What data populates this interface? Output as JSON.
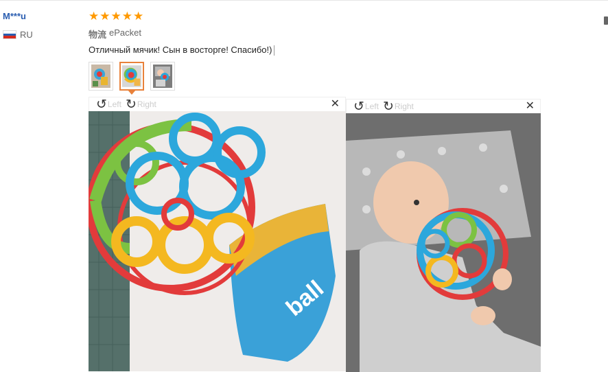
{
  "review": {
    "username": "M***u",
    "country_code": "RU",
    "star_count": 5,
    "rating_label": "★",
    "shipping_label": "物流",
    "shipping_method": "ePacket",
    "text": "Отличный мячик! Сын в восторге! Спасибо!)"
  },
  "colors": {
    "accent": "#e8813a",
    "star": "#ff9900",
    "username": "#2a5db0"
  },
  "viewers": [
    {
      "rotate_left_label": "Left",
      "rotate_right_label": "Right",
      "close_label": "✕"
    },
    {
      "rotate_left_label": "Left",
      "rotate_right_label": "Right",
      "close_label": "✕"
    }
  ],
  "icons": {
    "rotate_left": "rotate-left-icon",
    "rotate_right": "rotate-right-icon",
    "close": "close-icon",
    "flag": "russia-flag-icon",
    "star": "star-icon"
  }
}
